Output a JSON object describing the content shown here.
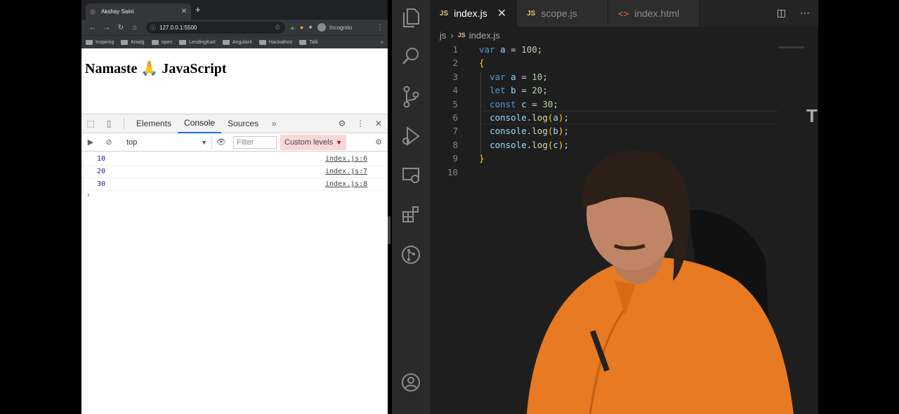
{
  "browser": {
    "tab_title": "Akshay Saini",
    "url": "127.0.0.1:5500",
    "profile_label": "Incognito",
    "bookmarks": [
      "Inspiring",
      "Knwlg",
      "open",
      "LendingKart",
      "Angular4",
      "Hackathon",
      "Talk"
    ],
    "page_heading": "Namaste 🙏 JavaScript",
    "devtools": {
      "tabs": [
        "Elements",
        "Console",
        "Sources"
      ],
      "active_tab": "Console",
      "context": "top",
      "filter_placeholder": "Filter",
      "levels_label": "Custom levels",
      "console_rows": [
        {
          "value": "10",
          "source": "index.js:6"
        },
        {
          "value": "20",
          "source": "index.js:7"
        },
        {
          "value": "30",
          "source": "index.js:8"
        }
      ]
    }
  },
  "editor": {
    "tabs": [
      {
        "label": "index.js",
        "type": "JS",
        "active": true
      },
      {
        "label": "scope.js",
        "type": "JS",
        "active": false
      },
      {
        "label": "index.html",
        "type": "HTML",
        "active": false
      }
    ],
    "breadcrumb": {
      "folder": "js",
      "file": "index.js",
      "file_type": "JS"
    },
    "line_numbers": [
      "1",
      "2",
      "3",
      "4",
      "5",
      "6",
      "7",
      "8",
      "9",
      "10"
    ],
    "minimap_letter": "T"
  },
  "colors": {
    "keyword": "#569cd6",
    "number": "#b5cea8",
    "function": "#dcdcaa",
    "variable": "#9cdcfe",
    "bracket": "#ffd700",
    "console_value": "#1a1aa6",
    "active_tab_underline": "#1a73e8"
  }
}
